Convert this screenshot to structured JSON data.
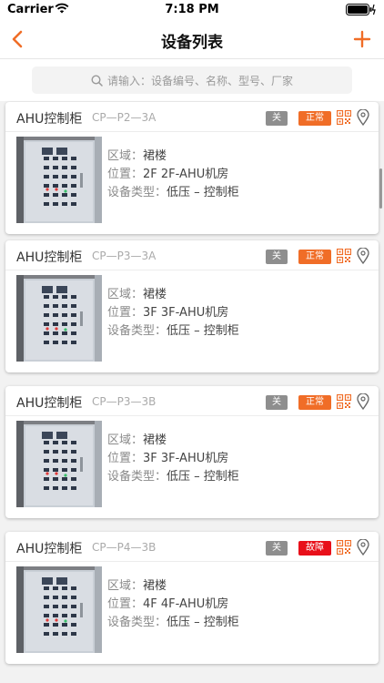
{
  "status_bar": {
    "carrier": "Carrier",
    "time": "7:18 PM"
  },
  "nav": {
    "title": "设备列表"
  },
  "search": {
    "placeholder": "请输入：设备编号、名称、型号、厂家"
  },
  "colors": {
    "accent": "#f06d27",
    "normal": "#f06d27",
    "fault": "#e8101a",
    "off": "#8e8e8e"
  },
  "cards": [
    {
      "name": "AHU控制柜",
      "code": "CP—P2—3A",
      "power": "关",
      "status": "正常",
      "area_label": "区域：",
      "area": "裙楼",
      "position_label": "位置：",
      "position": "2F   2F-AHU机房",
      "type_label": "设备类型：",
      "type": "低压 – 控制柜"
    },
    {
      "name": "AHU控制柜",
      "code": "CP—P3—3A",
      "power": "关",
      "status": "正常",
      "area_label": "区域：",
      "area": "裙楼",
      "position_label": "位置：",
      "position": "3F   3F-AHU机房",
      "type_label": "设备类型：",
      "type": "低压 – 控制柜"
    },
    {
      "name": "AHU控制柜",
      "code": "CP—P3—3B",
      "power": "关",
      "status": "正常",
      "area_label": "区域：",
      "area": "裙楼",
      "position_label": "位置：",
      "position": "3F   3F-AHU机房",
      "type_label": "设备类型：",
      "type": "低压 – 控制柜"
    },
    {
      "name": "AHU控制柜",
      "code": "CP—P4—3B",
      "power": "关",
      "status": "故障",
      "area_label": "区域：",
      "area": "裙楼",
      "position_label": "位置：",
      "position": "4F   4F-AHU机房",
      "type_label": "设备类型：",
      "type": "低压 – 控制柜"
    }
  ]
}
